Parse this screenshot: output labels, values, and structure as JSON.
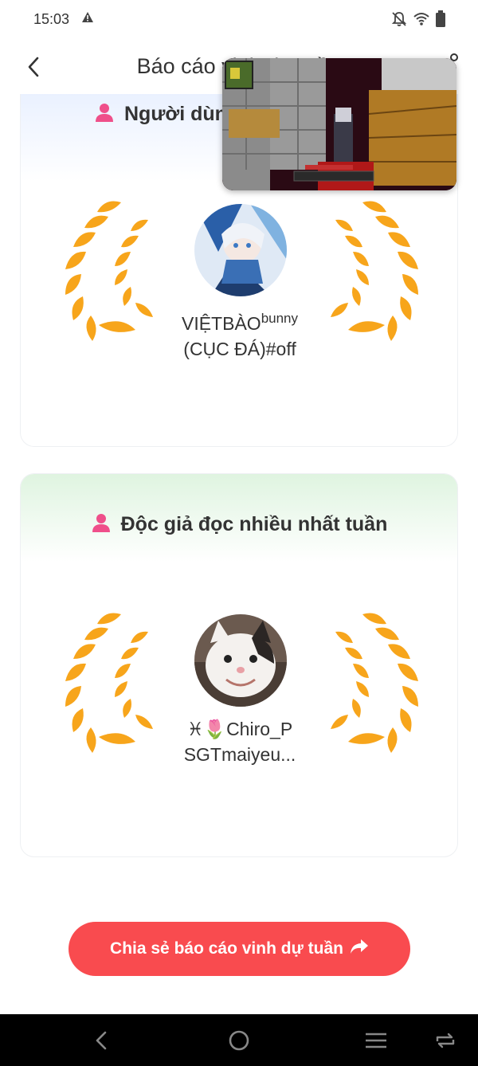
{
  "status_bar": {
    "time": "15:03",
    "icons": [
      "warning-icon",
      "bell-off-icon",
      "wifi-icon",
      "battery-icon"
    ]
  },
  "header": {
    "title": "Báo cáo vinh dự tuần"
  },
  "cards": [
    {
      "title": "Người dùng",
      "user_name_main": "VIỆTBÀO",
      "user_name_sup": "bunny",
      "user_name_line2": "(CỤC ĐÁ)#off"
    },
    {
      "title": "Độc giả đọc nhiều nhất tuần",
      "user_name_line1": "♓🌷Chiro_P",
      "user_name_line2": "SGTmaiyeu..."
    }
  ],
  "share_button": {
    "label": "Chia sẻ báo cáo vinh dự tuần"
  },
  "colors": {
    "accent": "#f94b4f",
    "laurel": "#f7a51b",
    "card1_header": "#eaf1ff",
    "card2_header": "#dff4e0",
    "person_icon": "#ef4f8a"
  }
}
